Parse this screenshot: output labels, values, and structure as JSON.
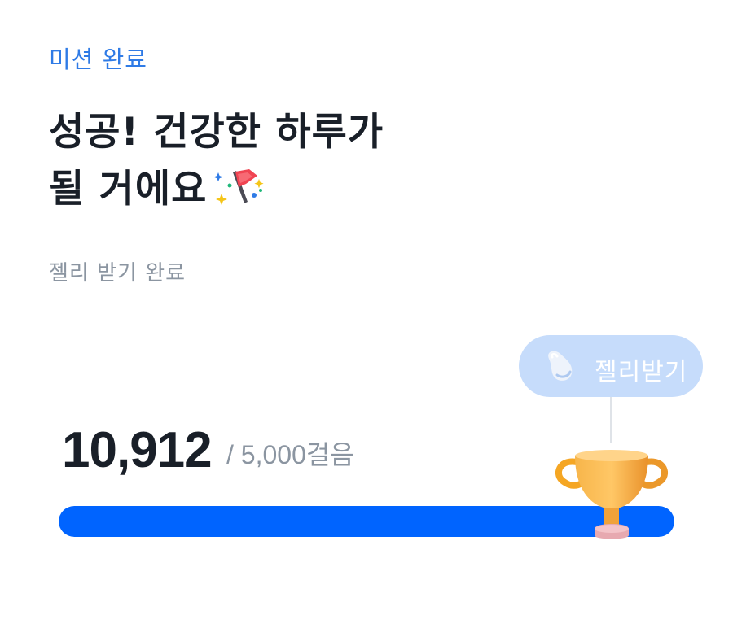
{
  "mission": {
    "eyebrow": "미션 완료"
  },
  "headline": {
    "line1": "성공! 건강한 하루가",
    "line2": "될 거에요",
    "icon": "party-popper-icon"
  },
  "subtitle": "젤리 받기 완료",
  "jelly_button": {
    "label": "젤리받기",
    "icon": "jelly-bean-icon"
  },
  "steps": {
    "count": "10,912",
    "goal": "/ 5,000걸음",
    "progress_fraction": 1.0
  },
  "trophy": {
    "icon": "trophy-icon"
  },
  "colors": {
    "accent": "#0064ff",
    "eyebrow": "#2f7be6",
    "muted": "#8b95a1",
    "pill": "#c6dcfb",
    "trophy": "#f5a623"
  }
}
